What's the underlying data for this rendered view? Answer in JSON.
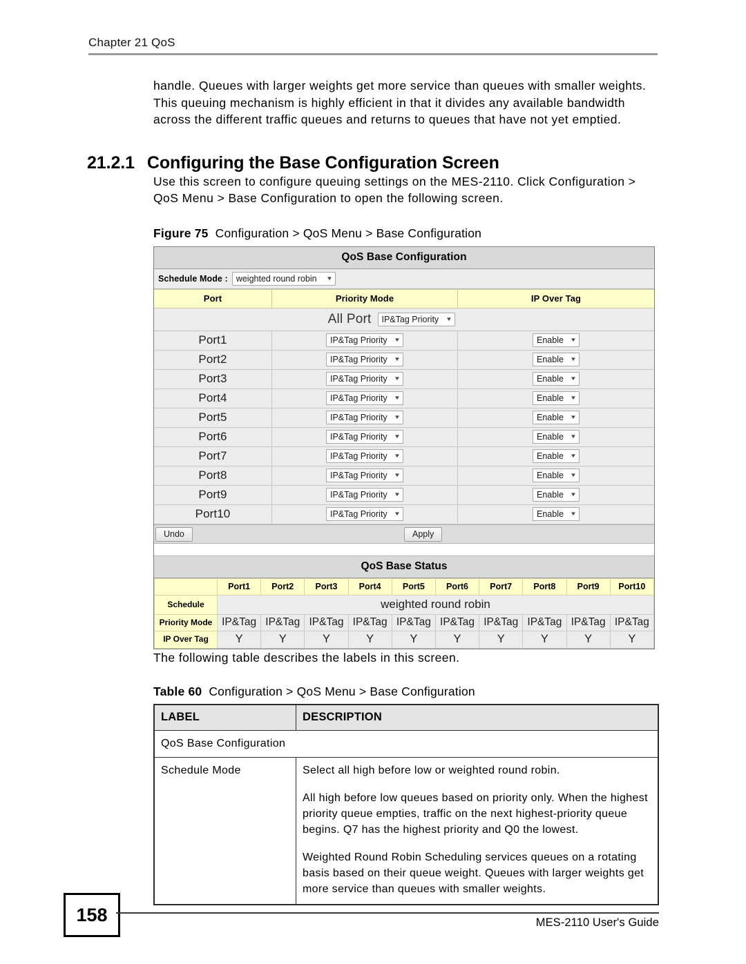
{
  "page": {
    "running_head": "Chapter 21 QoS",
    "page_number": "158",
    "footer_guide": "MES-2110 User's Guide"
  },
  "body": {
    "intro_paragraph": "handle. Queues with larger weights get more service than queues with smaller weights. This queuing mechanism is highly efficient in that it divides any available bandwidth across the different traffic queues and returns to queues that have not yet emptied.",
    "section_number": "21.2.1",
    "section_title": "Configuring the Base Configuration Screen",
    "section_intro": "Use this screen to configure queuing settings on the MES-2110. Click Configuration > QoS Menu > Base Configuration to open the following screen.",
    "figure_lead": "Figure 75",
    "figure_caption": "Configuration > QoS Menu > Base Configuration",
    "after_figure": "The following table describes the labels in this screen.",
    "table_lead": "Table 60",
    "table_caption": "Configuration > QoS Menu > Base Configuration"
  },
  "screenshot": {
    "panel_title": "QoS Base Configuration",
    "schedule_mode_label": "Schedule Mode :",
    "schedule_mode_value": "weighted round robin",
    "columns": {
      "port": "Port",
      "priority_mode": "Priority Mode",
      "ip_over_tag": "IP Over Tag"
    },
    "all_port_label": "All Port",
    "all_port_priority": "IP&Tag Priority",
    "rows": [
      {
        "port": "Port1",
        "priority": "IP&Tag Priority",
        "tag": "Enable"
      },
      {
        "port": "Port2",
        "priority": "IP&Tag Priority",
        "tag": "Enable"
      },
      {
        "port": "Port3",
        "priority": "IP&Tag Priority",
        "tag": "Enable"
      },
      {
        "port": "Port4",
        "priority": "IP&Tag Priority",
        "tag": "Enable"
      },
      {
        "port": "Port5",
        "priority": "IP&Tag Priority",
        "tag": "Enable"
      },
      {
        "port": "Port6",
        "priority": "IP&Tag Priority",
        "tag": "Enable"
      },
      {
        "port": "Port7",
        "priority": "IP&Tag Priority",
        "tag": "Enable"
      },
      {
        "port": "Port8",
        "priority": "IP&Tag Priority",
        "tag": "Enable"
      },
      {
        "port": "Port9",
        "priority": "IP&Tag Priority",
        "tag": "Enable"
      },
      {
        "port": "Port10",
        "priority": "IP&Tag Priority",
        "tag": "Enable"
      }
    ],
    "buttons": {
      "undo": "Undo",
      "apply": "Apply"
    },
    "status": {
      "title": "QoS Base Status",
      "port_headers": [
        "Port1",
        "Port2",
        "Port3",
        "Port4",
        "Port5",
        "Port6",
        "Port7",
        "Port8",
        "Port9",
        "Port10"
      ],
      "row_labels": {
        "schedule": "Schedule",
        "priority_mode": "Priority Mode",
        "ip_over_tag": "IP Over Tag"
      },
      "schedule_value": "weighted round robin",
      "priority_mode_values": [
        "IP&Tag",
        "IP&Tag",
        "IP&Tag",
        "IP&Tag",
        "IP&Tag",
        "IP&Tag",
        "IP&Tag",
        "IP&Tag",
        "IP&Tag",
        "IP&Tag"
      ],
      "ip_over_tag_values": [
        "Y",
        "Y",
        "Y",
        "Y",
        "Y",
        "Y",
        "Y",
        "Y",
        "Y",
        "Y"
      ]
    },
    "colors": {
      "header_yellow": "#ffffcc",
      "panel_gray": "#d9d9d9",
      "row_gray": "#ececec"
    }
  },
  "doc_table": {
    "headers": {
      "label": "LABEL",
      "description": "DESCRIPTION"
    },
    "section_row": "QoS Base Configuration",
    "rows": [
      {
        "label": "Schedule Mode",
        "desc_1": "Select all high before low or weighted round robin.",
        "desc_2": "All high before low queues based on priority only. When the highest priority queue empties, traffic on the next highest-priority queue begins. Q7 has the highest priority and Q0 the lowest.",
        "desc_3": "Weighted Round Robin Scheduling services queues on a rotating basis based on their queue weight. Queues with larger weights get more service than queues with smaller weights."
      }
    ]
  }
}
